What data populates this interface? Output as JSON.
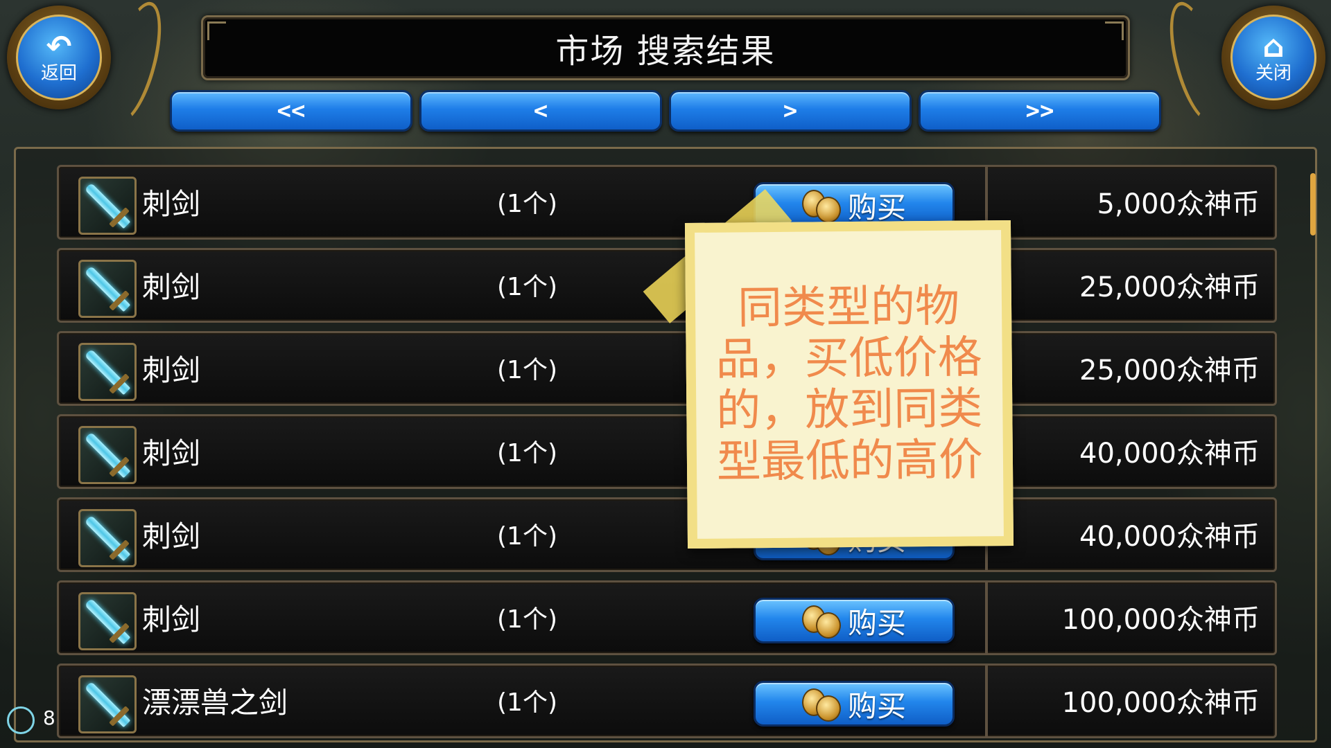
{
  "header": {
    "title": "市场 搜索结果",
    "back_label": "返回",
    "close_label": "关闭",
    "back_icon": "undo-arrow-icon",
    "close_icon": "house-icon"
  },
  "pager": {
    "first": "<<",
    "prev": "<",
    "next": ">",
    "last": ">>"
  },
  "buy_label": "购买",
  "listings": [
    {
      "name": "刺剑",
      "qty": "(1个)",
      "price": "5,000众神币"
    },
    {
      "name": "刺剑",
      "qty": "(1个)",
      "price": "25,000众神币"
    },
    {
      "name": "刺剑",
      "qty": "(1个)",
      "price": "25,000众神币"
    },
    {
      "name": "刺剑",
      "qty": "(1个)",
      "price": "40,000众神币"
    },
    {
      "name": "刺剑",
      "qty": "(1个)",
      "price": "40,000众神币"
    },
    {
      "name": "刺剑",
      "qty": "(1个)",
      "price": "100,000众神币"
    },
    {
      "name": "漂漂兽之剑",
      "qty": "(1个)",
      "price": "100,000众神币"
    }
  ],
  "note": {
    "text": "同类型的物品，买低价格的，放到同类型最低的高价"
  },
  "corner_counter": "8",
  "colors": {
    "button_blue": "#1e7de8",
    "frame_gold": "#7a6a4a",
    "note_text": "#f08a4c",
    "note_bg": "#f9f3cf"
  }
}
